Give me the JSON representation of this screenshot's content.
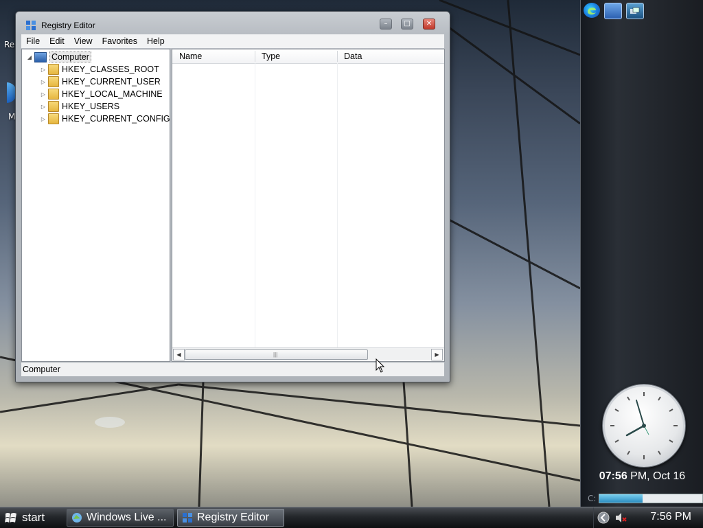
{
  "desktop": {
    "icon_label_fragments": [
      "Re",
      "M"
    ]
  },
  "sidebar": {
    "quick_launch": [
      "edge-icon",
      "show-desktop-icon",
      "flip-3d-icon"
    ],
    "clock": {
      "time_bold": "07:56",
      "suffix": " PM, Oct 16"
    },
    "drive": {
      "label": "C:",
      "used_fraction": 0.42
    }
  },
  "taskbar": {
    "start_label": "start",
    "buttons": [
      {
        "label": "Windows Live ...",
        "icon": "windows-live-icon"
      },
      {
        "label": "Registry Editor",
        "icon": "regedit-icon"
      }
    ],
    "tray_time": "7:56 PM"
  },
  "regedit": {
    "title": "Registry Editor",
    "menu": [
      "File",
      "Edit",
      "View",
      "Favorites",
      "Help"
    ],
    "tree": {
      "root": "Computer",
      "children": [
        "HKEY_CLASSES_ROOT",
        "HKEY_CURRENT_USER",
        "HKEY_LOCAL_MACHINE",
        "HKEY_USERS",
        "HKEY_CURRENT_CONFIG"
      ]
    },
    "columns": [
      "Name",
      "Type",
      "Data"
    ],
    "status": "Computer"
  },
  "colors": {
    "title_bar": "#c9cdd2",
    "close_button": "#c0392b",
    "taskbar": "#24272b",
    "folder": "#e6b640"
  }
}
